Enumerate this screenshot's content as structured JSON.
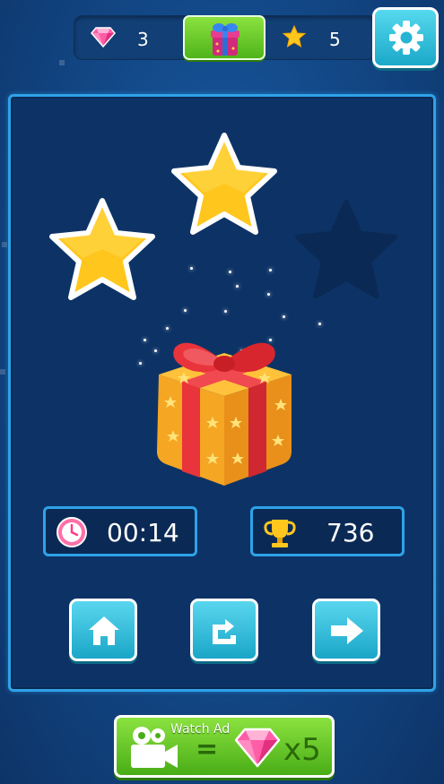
{
  "topbar": {
    "gems": "3",
    "stars": "5",
    "gem_icon": "gem-icon",
    "star_icon": "star-icon",
    "gift_icon": "gift-icon",
    "settings_icon": "gear-icon"
  },
  "level_result": {
    "stars_earned": 2,
    "stars_total": 3
  },
  "stats": {
    "time": "00:14",
    "score": "736",
    "timer_icon": "clock-icon",
    "score_icon": "trophy-icon"
  },
  "nav": {
    "home_icon": "home-icon",
    "restart_icon": "restart-icon",
    "next_icon": "arrow-right-icon"
  },
  "watch_ad": {
    "label": "Watch Ad",
    "equals": "=",
    "reward": "x5",
    "camera_icon": "video-camera-icon",
    "reward_icon": "gem-icon"
  },
  "colors": {
    "background": "#134a8a",
    "panel_border": "#2fa2e8",
    "star_gold": "#ffc61e",
    "star_empty": "#0a2a55",
    "button_cyan": "#2bbbd9",
    "button_green": "#6ccb2a",
    "gift_ribbon": "#e8343a"
  }
}
